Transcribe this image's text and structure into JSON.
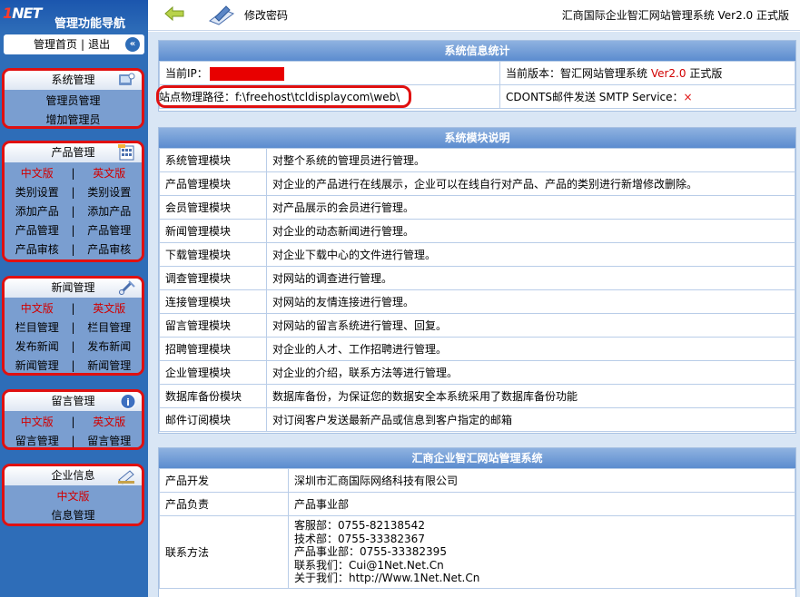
{
  "sidebar": {
    "logo_prefix": "1",
    "logo_suffix": "NET",
    "title": "管理功能导航",
    "home_link": "管理首页",
    "separator": "|",
    "logout_link": "退出",
    "collapse_icon": "«",
    "menus": [
      {
        "title": "系统管理",
        "icon": "system-icon",
        "items": [
          "管理员管理",
          "增加管理员"
        ]
      },
      {
        "title": "产品管理",
        "icon": "product-icon",
        "lang": [
          "中文版",
          "英文版"
        ],
        "rows": [
          [
            "类别设置",
            "类别设置"
          ],
          [
            "添加产品",
            "添加产品"
          ],
          [
            "产品管理",
            "产品管理"
          ],
          [
            "产品审核",
            "产品审核"
          ]
        ]
      },
      {
        "title": "新闻管理",
        "icon": "news-icon",
        "lang": [
          "中文版",
          "英文版"
        ],
        "rows": [
          [
            "栏目管理",
            "栏目管理"
          ],
          [
            "发布新闻",
            "发布新闻"
          ],
          [
            "新闻管理",
            "新闻管理"
          ]
        ]
      },
      {
        "title": "留言管理",
        "icon": "info-icon",
        "lang": [
          "中文版",
          "英文版"
        ],
        "rows": [
          [
            "留言管理",
            "留言管理"
          ]
        ]
      },
      {
        "title": "企业信息",
        "icon": "company-icon",
        "single_red": "中文版",
        "items": [
          "信息管理"
        ]
      }
    ]
  },
  "topbar": {
    "breadcrumb": "修改密码",
    "system_title": "汇商国际企业智汇网站管理系统 Ver2.0 正式版"
  },
  "stats": {
    "heading": "系统信息统计",
    "ip_label": "当前IP：",
    "version_label": "当前版本：智汇网站管理系统 ",
    "version_value": "Ver2.0",
    "version_suffix": " 正式版",
    "path_label": "站点物理路径：f:\\freehost\\tcldisplaycom\\web\\",
    "mail_label": "CDONTS邮件发送 SMTP Service：",
    "mail_status": "×"
  },
  "modules": {
    "heading": "系统模块说明",
    "rows": [
      [
        "系统管理模块",
        "对整个系统的管理员进行管理。"
      ],
      [
        "产品管理模块",
        "对企业的产品进行在线展示，企业可以在线自行对产品、产品的类别进行新增修改删除。"
      ],
      [
        "会员管理模块",
        "对产品展示的会员进行管理。"
      ],
      [
        "新闻管理模块",
        "对企业的动态新闻进行管理。"
      ],
      [
        "下载管理模块",
        "对企业下载中心的文件进行管理。"
      ],
      [
        "调查管理模块",
        "对网站的调查进行管理。"
      ],
      [
        "连接管理模块",
        "对网站的友情连接进行管理。"
      ],
      [
        "留言管理模块",
        "对网站的留言系统进行管理、回复。"
      ],
      [
        "招聘管理模块",
        "对企业的人才、工作招聘进行管理。"
      ],
      [
        "企业管理模块",
        "对企业的介绍，联系方法等进行管理。"
      ],
      [
        "数据库备份模块",
        "数据库备份，为保证您的数据安全本系统采用了数据库备份功能"
      ],
      [
        "邮件订阅模块",
        "对订阅客户发送最新产品或信息到客户指定的邮箱"
      ]
    ]
  },
  "about": {
    "heading": "汇商企业智汇网站管理系统",
    "dev_label": "产品开发",
    "dev_value": "深圳市汇商国际网络科技有限公司",
    "owner_label": "产品负责",
    "owner_value": "产品事业部",
    "contact_label": "联系方法",
    "contacts": [
      "客服部：0755-82138542",
      "技术部：0755-33382367",
      "产品事业部：0755-33382395",
      "联系我们：Cui@1Net.Net.Cn",
      "关于我们：http://Www.1Net.Net.Cn"
    ]
  }
}
